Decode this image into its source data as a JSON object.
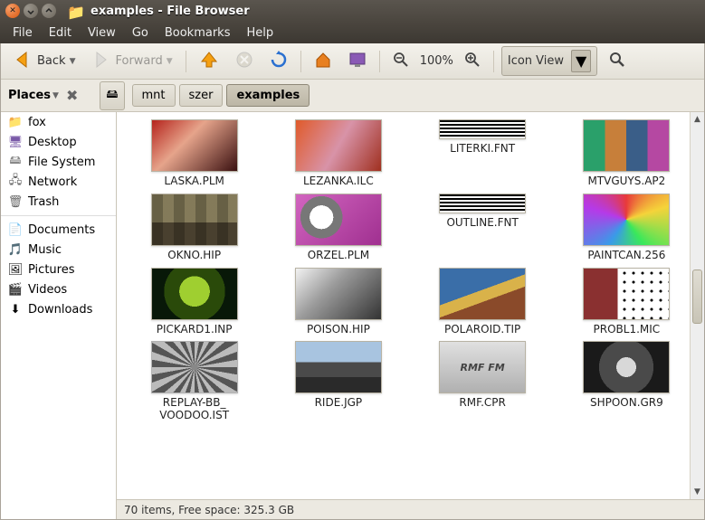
{
  "window": {
    "title": "examples - File Browser"
  },
  "menubar": [
    "File",
    "Edit",
    "View",
    "Go",
    "Bookmarks",
    "Help"
  ],
  "toolbar": {
    "back_label": "Back",
    "forward_label": "Forward",
    "zoom_label": "100%",
    "view_mode": "Icon View"
  },
  "sidebar_header": "Places",
  "sidebar": [
    {
      "label": "fox",
      "icon": "📁",
      "color": "#d97a1a"
    },
    {
      "label": "Desktop",
      "icon": "🖥",
      "color": "#7a5aa8"
    },
    {
      "label": "File System",
      "icon": "🖴",
      "color": "#888"
    },
    {
      "label": "Network",
      "icon": "🖧",
      "color": "#666"
    },
    {
      "label": "Trash",
      "icon": "🗑",
      "color": "#666"
    }
  ],
  "sidebar2": [
    {
      "label": "Documents",
      "icon": "📄"
    },
    {
      "label": "Music",
      "icon": "🎵"
    },
    {
      "label": "Pictures",
      "icon": "🖼"
    },
    {
      "label": "Videos",
      "icon": "🎬"
    },
    {
      "label": "Downloads",
      "icon": "⬇"
    }
  ],
  "breadcrumbs": [
    "mnt",
    "szer",
    "examples"
  ],
  "files": [
    {
      "label": "LASKA.PLM",
      "thumb": "th-laska"
    },
    {
      "label": "LEZANKA.ILC",
      "thumb": "th-lezanka"
    },
    {
      "label": "LITERKI.FNT",
      "thumb": "th-literki",
      "small": true
    },
    {
      "label": "MTVGUYS.AP2",
      "thumb": "th-mtvguys"
    },
    {
      "label": "OKNO.HIP",
      "thumb": "th-okno"
    },
    {
      "label": "ORZEL.PLM",
      "thumb": "th-orzel"
    },
    {
      "label": "OUTLINE.FNT",
      "thumb": "th-outline",
      "small": true
    },
    {
      "label": "PAINTCAN.256",
      "thumb": "th-paintcan"
    },
    {
      "label": "PICKARD1.INP",
      "thumb": "th-pickard"
    },
    {
      "label": "POISON.HIP",
      "thumb": "th-poison"
    },
    {
      "label": "POLAROID.TIP",
      "thumb": "th-polaroid"
    },
    {
      "label": "PROBL1.MIC",
      "thumb": "th-probl"
    },
    {
      "label": "REPLAY-BB_ VOODOO.IST",
      "thumb": "th-replay"
    },
    {
      "label": "RIDE.JGP",
      "thumb": "th-ride"
    },
    {
      "label": "RMF.CPR",
      "thumb": "th-rmf",
      "text": "RMF FM"
    },
    {
      "label": "SHPOON.GR9",
      "thumb": "th-shpoon"
    }
  ],
  "statusbar": "70 items, Free space: 325.3 GB"
}
